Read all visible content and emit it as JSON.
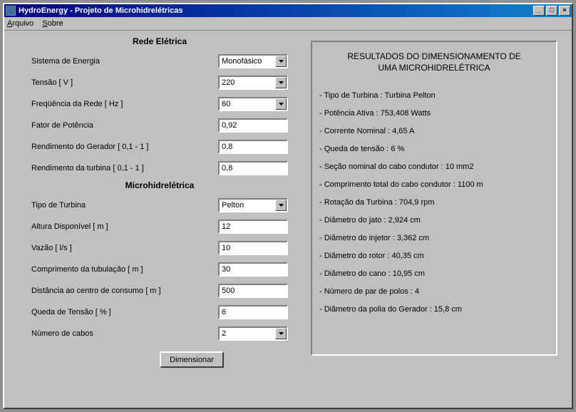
{
  "window": {
    "title": "HydroEnergy - Projeto de Microhidrelétricas"
  },
  "menu": {
    "arquivo": "Arquivo",
    "sobre": "Sobre"
  },
  "sections": {
    "rede": "Rede Elétrica",
    "micro": "Microhidrelétrica"
  },
  "labels": {
    "sistema": "Sistema de Energia",
    "tensao": "Tensão [ V ]",
    "frequencia": "Freqüência da Rede [ Hz ]",
    "fator": "Fator de Potência",
    "rend_gerador": "Rendimento do Gerador [ 0,1 - 1 ]",
    "rend_turbina": "Rendimento da turbina [ 0,1 - 1 ]",
    "tipo_turbina": "Tipo de Turbina",
    "altura": "Altura Disponível [ m ]",
    "vazao": "Vazão [ l/s ]",
    "comprimento": "Comprimento da tubulação [ m ]",
    "distancia": "Distância ao centro de consumo [ m ]",
    "queda": "Queda de Tensão [ % ]",
    "numero_cabos": "Número de cabos"
  },
  "values": {
    "sistema": "Monofásico",
    "tensao": "220",
    "frequencia": "60",
    "fator": "0,92",
    "rend_gerador": "0,8",
    "rend_turbina": "0,8",
    "tipo_turbina": "Pelton",
    "altura": "12",
    "vazao": "10",
    "comprimento": "30",
    "distancia": "500",
    "queda": "6",
    "numero_cabos": "2"
  },
  "button": {
    "dimensionar": "Dimensionar"
  },
  "results": {
    "header1": "RESULTADOS DO DIMENSIONAMENTO DE",
    "header2": "UMA MICROHIDRELÉTRICA",
    "lines": [
      "- Tipo de Turbina : Turbina Pelton",
      "- Potência Ativa : 753,408 Watts",
      "- Corrente Nominal : 4,65 A",
      "- Queda de tensão : 6 %",
      "- Seção nominal do cabo condutor : 10 mm2",
      "- Comprimento total do cabo condutor : 1100 m",
      "- Rotação da Turbina : 704,9 rpm",
      "- Diâmetro do jato : 2,924 cm",
      "- Diâmetro do injetor : 3,362 cm",
      "- Diâmetro do rotor : 40,35 cm",
      "- Diâmetro do cano : 10,95 cm",
      "- Número de par de polos : 4",
      "- Diâmetro da polia do Gerador : 15,8 cm"
    ]
  }
}
